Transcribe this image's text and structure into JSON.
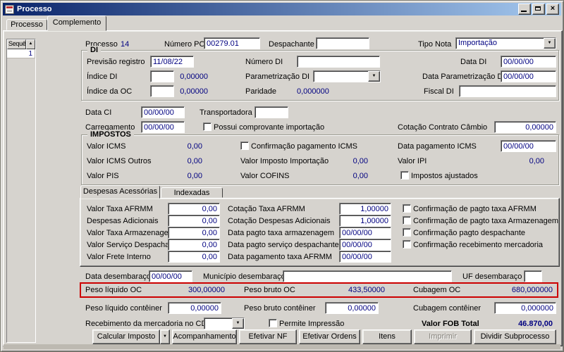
{
  "icons": {
    "close": "×",
    "dropdown": "▼",
    "scroll_up": "▲"
  },
  "window": {
    "title": "Processo"
  },
  "main_tabs": {
    "processo": "Processo",
    "complemento": "Complemento"
  },
  "sidebar": {
    "header": "Sequência",
    "row1": "1"
  },
  "top": {
    "processo_label": "Processo",
    "processo_value": "14",
    "numero_po_label": "Número PO",
    "numero_po_value": "00279.01",
    "despachante_label": "Despachante",
    "despachante_value": "",
    "tipo_nota_label": "Tipo Nota",
    "tipo_nota_value": "Importação"
  },
  "di": {
    "title": "DI",
    "previsao_label": "Previsão registro",
    "previsao_value": "11/08/22",
    "numero_di_label": "Número DI",
    "numero_di_value": "",
    "data_di_label": "Data DI",
    "data_di_value": "00/00/00",
    "indice_di_label": "Índice DI",
    "indice_di_value": "",
    "indice_di_display": "0,00000",
    "parametrizacao_label": "Parametrização DI",
    "parametrizacao_value": "",
    "data_param_label": "Data Parametrização DI",
    "data_param_value": "00/00/00",
    "indice_oc_label": "Índice da OC",
    "indice_oc_value": "",
    "indice_oc_display": "0,00000",
    "paridade_label": "Paridade",
    "paridade_value": "0,000000",
    "fiscal_di_label": "Fiscal DI",
    "fiscal_di_value": ""
  },
  "ci": {
    "data_ci_label": "Data CI",
    "data_ci_value": "00/00/00",
    "transportadora_label": "Transportadora",
    "transportadora_value": "",
    "carregamento_label": "Carregamento",
    "carregamento_value": "00/00/00",
    "comprovante_label": "Possui comprovante importação",
    "cotacao_label": "Cotação Contrato Câmbio",
    "cotacao_value": "0,00000"
  },
  "impostos": {
    "title": "IMPOSTOS",
    "icms_label": "Valor ICMS",
    "icms_value": "0,00",
    "conf_icms_label": "Confirmação pagamento ICMS",
    "data_icms_label": "Data pagamento ICMS",
    "data_icms_value": "00/00/00",
    "icms_outros_label": "Valor ICMS Outros",
    "icms_outros_value": "0,00",
    "imp_importacao_label": "Valor Imposto Importação",
    "imp_importacao_value": "0,00",
    "ipi_label": "Valor IPI",
    "ipi_value": "0,00",
    "pis_label": "Valor PIS",
    "pis_value": "0,00",
    "cofins_label": "Valor COFINS",
    "cofins_value": "0,00",
    "ajustados_label": "Impostos ajustados"
  },
  "despesas_tabs": {
    "acessorias": "Despesas Acessórias",
    "indexadas": "Indexadas"
  },
  "despesas": {
    "rows": [
      {
        "label": "Valor Taxa AFRMM",
        "value": "0,00",
        "label2": "Cotação Taxa AFRMM",
        "value2": "1,00000"
      },
      {
        "label": "Despesas Adicionais",
        "value": "0,00",
        "label2": "Cotação Despesas Adicionais",
        "value2": "1,00000"
      },
      {
        "label": "Valor Taxa Armazenagem",
        "value": "0,00",
        "label2": "Data pagto taxa armazenagem",
        "value2": "00/00/00"
      },
      {
        "label": "Valor Serviço Despachante",
        "value": "0,00",
        "label2": "Data pagto serviço despachante",
        "value2": "00/00/00"
      },
      {
        "label": "Valor Frete Interno",
        "value": "0,00",
        "label2": "Data pagamento taxa AFRMM",
        "value2": "00/00/00"
      }
    ],
    "checkboxes": [
      "Confirmação de pagto taxa AFRMM",
      "Confirmação de pagto taxa Armazenagem",
      "Confirmação pagto despachante",
      "Confirmação recebimento mercadoria"
    ]
  },
  "desembaraco": {
    "data_label": "Data desembaraço",
    "data_value": "00/00/00",
    "municipio_label": "Município desembaraço",
    "municipio_value": "",
    "uf_label": "UF desembaraço",
    "uf_value": ""
  },
  "pesos_oc": {
    "liquido_label": "Peso líquido OC",
    "liquido_value": "300,00000",
    "bruto_label": "Peso bruto OC",
    "bruto_value": "433,50000",
    "cubagem_label": "Cubagem OC",
    "cubagem_value": "680,000000"
  },
  "pesos_conteiner": {
    "liquido_label": "Peso líquido contêiner",
    "liquido_value": "0,00000",
    "bruto_label": "Peso bruto contêiner",
    "bruto_value": "0,00000",
    "cubagem_label": "Cubagem contêiner",
    "cubagem_value": "0,000000"
  },
  "rodape": {
    "recebimento_label": "Recebimento da mercadoria no CD",
    "recebimento_value": "",
    "permite_label": "Permite Impressão",
    "fob_label": "Valor FOB Total",
    "fob_value": "46.870,00"
  },
  "buttons": {
    "calcular": "Calcular Imposto",
    "acompanhamento": "Acompanhamento",
    "efetivar_nf": "Efetivar NF",
    "efetivar_ordens": "Efetivar Ordens",
    "itens": "Itens",
    "imprimir": "Imprimir",
    "dividir": "Dividir Subprocesso"
  },
  "colors": {
    "value_text": "#000080",
    "highlight_border": "#cc0000",
    "titlebar_start": "#0a246a",
    "titlebar_end": "#a6caf0",
    "face": "#d6d3ce"
  }
}
